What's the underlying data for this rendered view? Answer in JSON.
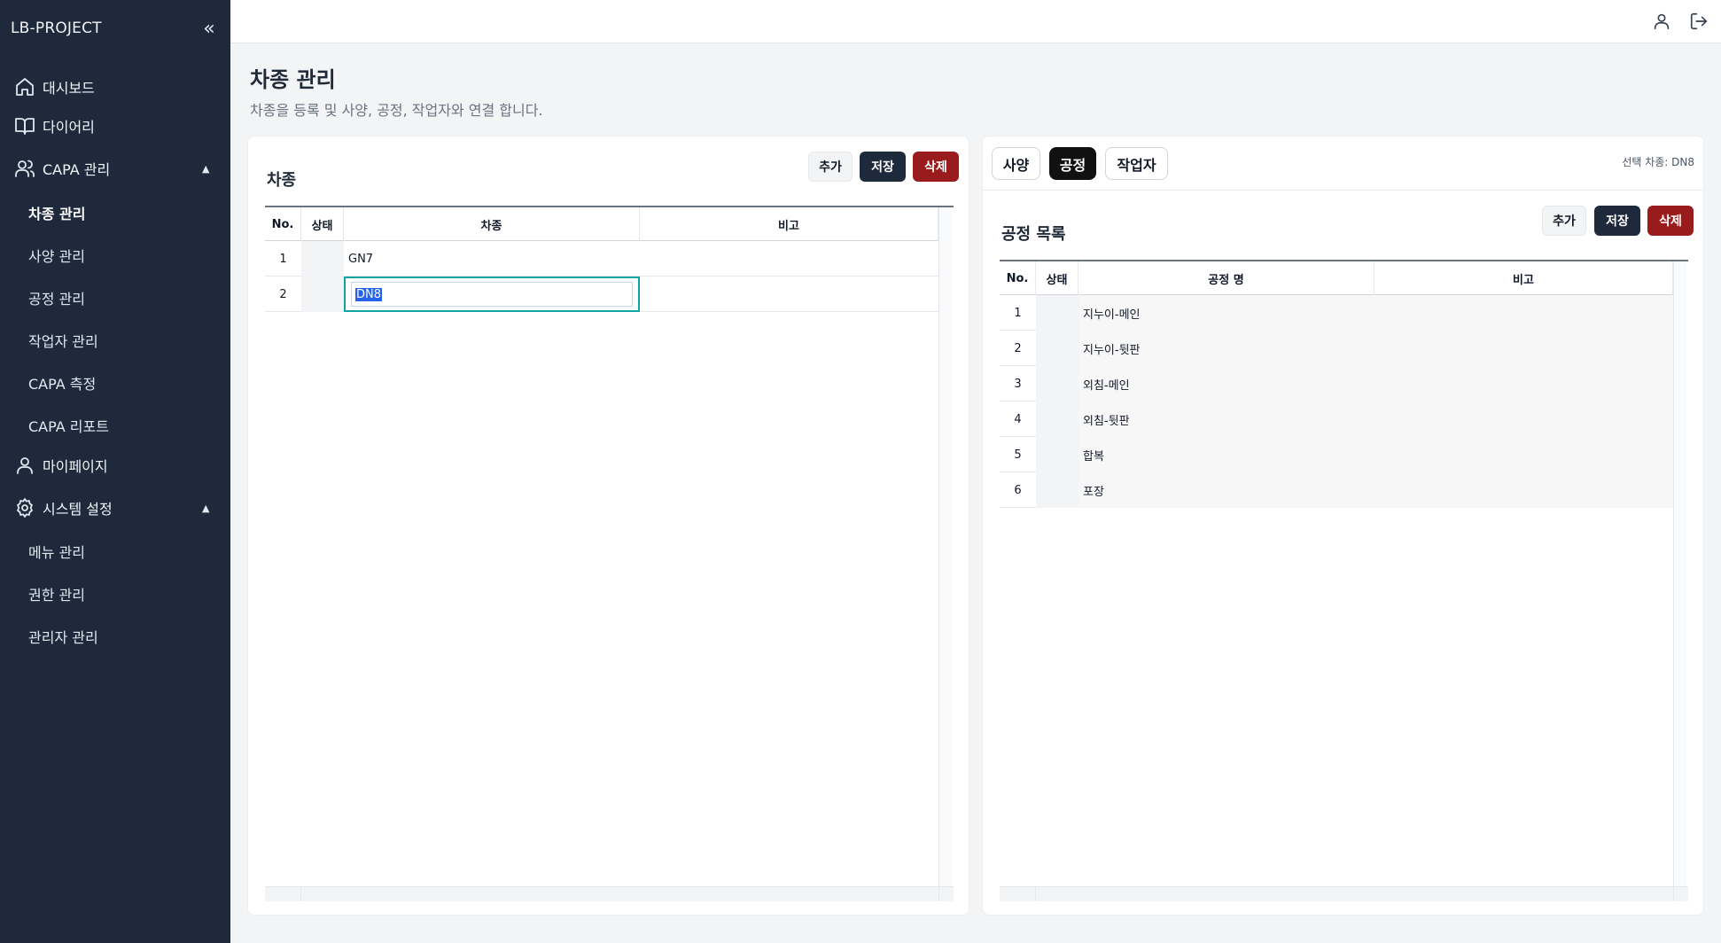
{
  "sidebar": {
    "brand": "LB-PROJECT",
    "collapse_icon": "chevrons-left-icon",
    "items": [
      {
        "label": "대시보드",
        "icon": "home-icon"
      },
      {
        "label": "다이어리",
        "icon": "book-open-icon"
      },
      {
        "label": "CAPA 관리",
        "icon": "users-icon",
        "expanded": true,
        "children": [
          {
            "label": "차종 관리",
            "active": true
          },
          {
            "label": "사양 관리"
          },
          {
            "label": "공정 관리"
          },
          {
            "label": "작업자 관리"
          },
          {
            "label": "CAPA 측정"
          },
          {
            "label": "CAPA 리포트"
          }
        ]
      },
      {
        "label": "마이페이지",
        "icon": "user-icon"
      },
      {
        "label": "시스템 설정",
        "icon": "gear-icon",
        "expanded": true,
        "children": [
          {
            "label": "메뉴 관리"
          },
          {
            "label": "권한 관리"
          },
          {
            "label": "관리자 관리"
          }
        ]
      }
    ]
  },
  "topbar": {
    "icons": [
      "user-icon",
      "logout-icon"
    ]
  },
  "page": {
    "title": "차종 관리",
    "subtitle": "차종을 등록 및 사양, 공정, 작업자와 연결 합니다."
  },
  "left_panel": {
    "title": "차종",
    "buttons": {
      "add": "추가",
      "save": "저장",
      "delete": "삭제"
    },
    "columns": [
      "No.",
      "상태",
      "차종",
      "비고"
    ],
    "rows": [
      {
        "no": "1",
        "status": "",
        "name": "GN7",
        "note": ""
      },
      {
        "no": "2",
        "status": "",
        "name": "DN8",
        "note": "",
        "editing": true
      }
    ]
  },
  "right_panel": {
    "tabs": [
      {
        "label": "사양",
        "active": false
      },
      {
        "label": "공정",
        "active": true
      },
      {
        "label": "작업자",
        "active": false
      }
    ],
    "selected_info": "선택 차종: DN8",
    "title": "공정 목록",
    "buttons": {
      "add": "추가",
      "save": "저장",
      "delete": "삭제"
    },
    "columns": [
      "No.",
      "상태",
      "공정 명",
      "비고"
    ],
    "rows": [
      {
        "no": "1",
        "status": "",
        "name": "지누이-메인",
        "note": ""
      },
      {
        "no": "2",
        "status": "",
        "name": "지누이-뒷판",
        "note": ""
      },
      {
        "no": "3",
        "status": "",
        "name": "외침-메인",
        "note": ""
      },
      {
        "no": "4",
        "status": "",
        "name": "외침-뒷판",
        "note": ""
      },
      {
        "no": "5",
        "status": "",
        "name": "합복",
        "note": ""
      },
      {
        "no": "6",
        "status": "",
        "name": "포장",
        "note": ""
      }
    ]
  },
  "colors": {
    "sidebar_bg": "#1e293b",
    "save_button": "#1e293b",
    "delete_button": "#991b1b",
    "edit_border": "#0ea5a4",
    "selection": "#2563eb"
  }
}
